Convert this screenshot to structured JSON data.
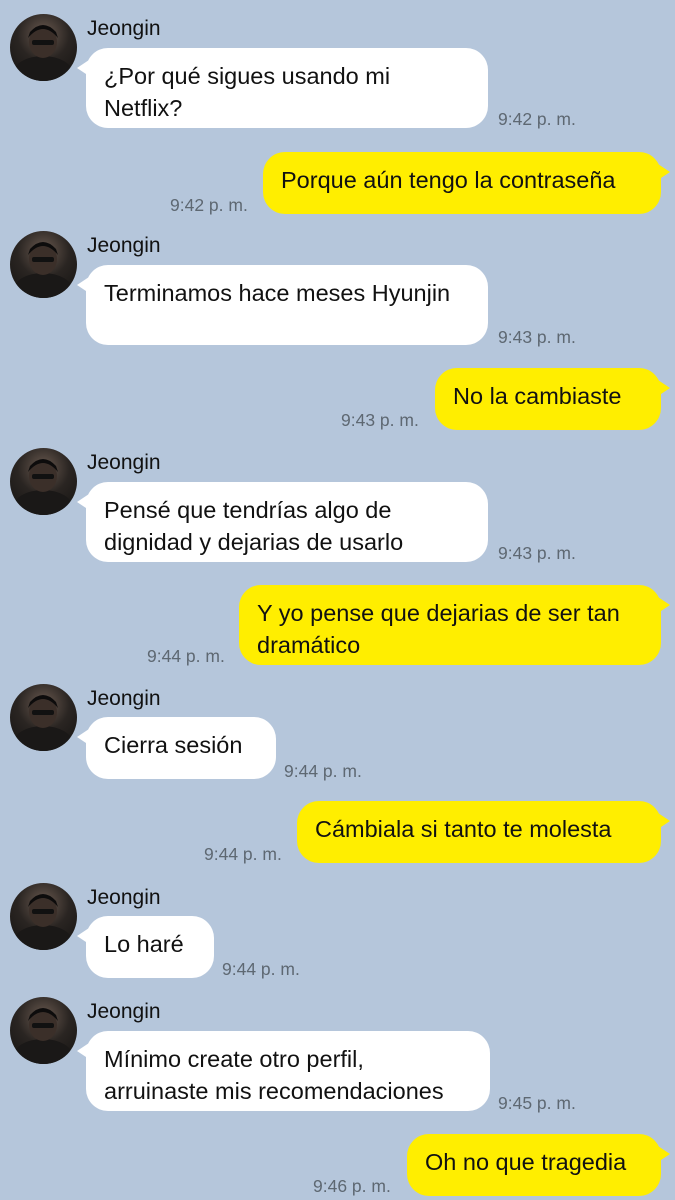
{
  "chat": {
    "messages": [
      {
        "type": "in",
        "sender": "Jeongin",
        "text": "¿Por qué sigues usando mi Netflix?",
        "time": "9:42 p. m."
      },
      {
        "type": "out",
        "text": "Porque aún tengo la contraseña",
        "time": "9:42 p. m."
      },
      {
        "type": "in",
        "sender": "Jeongin",
        "text": "Terminamos hace meses Hyunjin",
        "time": "9:43 p. m."
      },
      {
        "type": "out",
        "text": "No la cambiaste",
        "time": "9:43 p. m."
      },
      {
        "type": "in",
        "sender": "Jeongin",
        "text": "Pensé que tendrías algo de dignidad y dejarias de usarlo",
        "time": "9:43 p. m."
      },
      {
        "type": "out",
        "text": "Y yo pense que dejarias de ser tan dramático",
        "time": "9:44 p. m."
      },
      {
        "type": "in",
        "sender": "Jeongin",
        "text": "Cierra sesión",
        "time": "9:44 p. m."
      },
      {
        "type": "out",
        "text": "Cámbiala si tanto te molesta",
        "time": "9:44 p. m."
      },
      {
        "type": "in",
        "sender": "Jeongin",
        "text": "Lo haré",
        "time": "9:44 p. m."
      },
      {
        "type": "in",
        "sender": "Jeongin",
        "text": "Mínimo create otro perfil, arruinaste mis recomendaciones",
        "time": "9:45 p. m."
      },
      {
        "type": "out",
        "text": "Oh no que tragedia",
        "time": "9:46 p. m."
      }
    ]
  },
  "colors": {
    "background": "#b5c6db",
    "incoming_bubble": "#ffffff",
    "outgoing_bubble": "#ffee00",
    "timestamp": "#5e6872"
  }
}
